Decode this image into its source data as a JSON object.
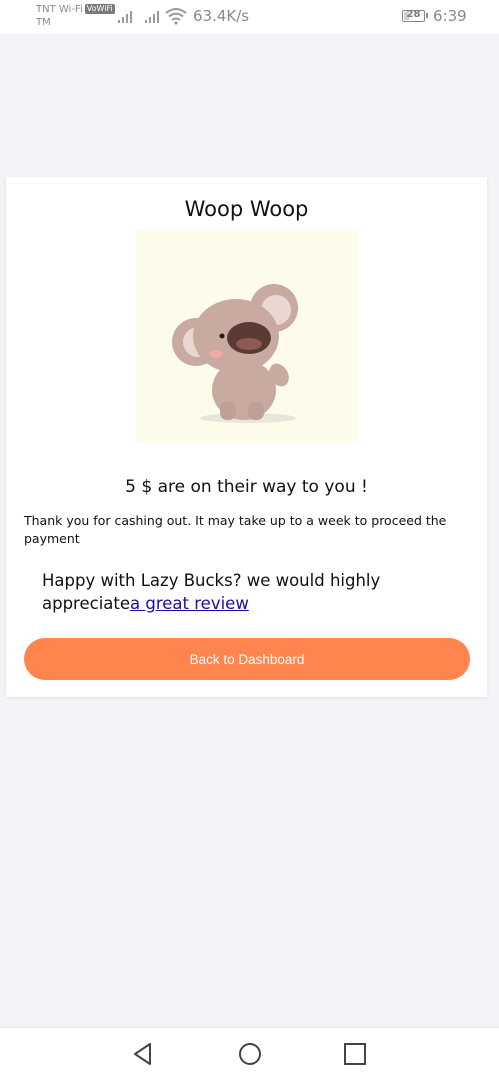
{
  "status_bar": {
    "carrier_line1": "TNT Wi-Fi",
    "carrier_badge": "VoWiFi",
    "carrier_line2": "TM",
    "net_speed": "63.4K/s",
    "battery": "28",
    "time": "6:39"
  },
  "card": {
    "title": "Woop Woop",
    "image_icon": "koala-illustration",
    "amount_text": "5 $ are on their way to you !",
    "thanks_text": "Thank you for cashing out. It may take up to a week to proceed the payment",
    "review_prefix": "Happy with Lazy Bucks? we would highly appreciate",
    "review_link": "a great review",
    "back_button_label": "Back to Dashboard"
  },
  "colors": {
    "accent": "#ff844e",
    "background": "#f4f4f8",
    "link": "#1a0dab"
  },
  "nav_bar": {
    "back_icon": "back-triangle-icon",
    "home_icon": "home-circle-icon",
    "recents_icon": "recents-square-icon"
  }
}
